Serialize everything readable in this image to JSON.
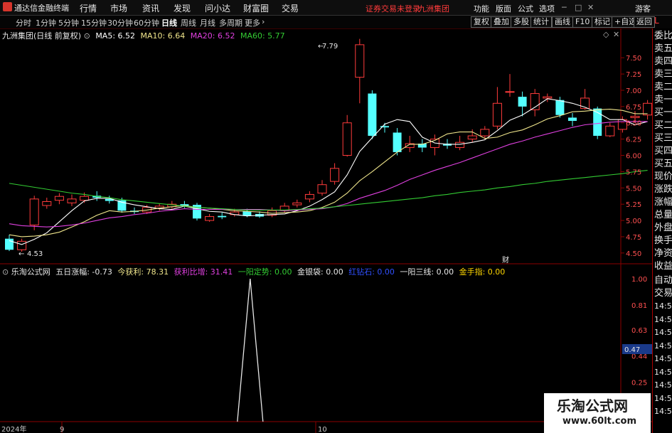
{
  "menubar": {
    "app_title": "通达信金融终端",
    "items": [
      "行情",
      "市场",
      "资讯",
      "发现",
      "问小达",
      "财富圈",
      "交易"
    ],
    "warning": "证券交易未登录",
    "stock_name": "九洲集团",
    "right_items": [
      "功能",
      "版面",
      "公式",
      "选项"
    ],
    "guest": "游客"
  },
  "periodbar": {
    "periods": [
      "分时",
      "1分钟",
      "5分钟",
      "15分钟",
      "30分钟",
      "60分钟",
      "日线",
      "周线",
      "月线",
      "多周期",
      "更多"
    ],
    "active": "日线",
    "buttons": [
      "复权",
      "叠加",
      "多股",
      "统计",
      "画线",
      "F10",
      "标记",
      "+自选",
      "返回"
    ]
  },
  "main_chart": {
    "title": "九洲集团(日线 前复权)",
    "ma": [
      {
        "label": "MA5: 6.52",
        "color": "#ffffff"
      },
      {
        "label": "MA10: 6.64",
        "color": "#f0e68c"
      },
      {
        "label": "MA20: 6.52",
        "color": "#e040e0"
      },
      {
        "label": "MA60: 5.77",
        "color": "#33cc33"
      }
    ],
    "high_label": "7.79",
    "low_label": "4.53",
    "cai_mark": "财",
    "y_ticks": [
      "7.50",
      "7.25",
      "7.00",
      "6.75",
      "6.50",
      "6.25",
      "6.00",
      "5.75",
      "5.50",
      "5.25",
      "5.00",
      "4.75",
      "4.50"
    ]
  },
  "indicator": {
    "name": "乐淘公式网",
    "fields": [
      {
        "label": "五日涨幅: -0.73",
        "color": "#e8e8e8"
      },
      {
        "label": "今获利: 78.31",
        "color": "#f0e68c"
      },
      {
        "label": "获利比增: 31.41",
        "color": "#e040e0"
      },
      {
        "label": "一阳定势: 0.00",
        "color": "#33cc33"
      },
      {
        "label": "金银袋: 0.00",
        "color": "#e8e8e8"
      },
      {
        "label": "红钻石: 0.00",
        "color": "#3050ff"
      },
      {
        "label": "一阳三线: 0.00",
        "color": "#e8e8e8"
      },
      {
        "label": "金手指: 0.00",
        "color": "#ffd700"
      }
    ],
    "y_ticks": [
      "1.00",
      "0.81",
      "0.63",
      "0.44",
      "0.25",
      "0.06"
    ],
    "cursor_value": "0.47"
  },
  "x_axis": {
    "labels": [
      "2024年",
      "9",
      "10"
    ]
  },
  "right_panel": {
    "items": [
      "委比",
      "卖五",
      "卖四",
      "卖三",
      "卖二",
      "卖一",
      "买一",
      "买二",
      "买三",
      "买四",
      "买五",
      "现价",
      "涨跌",
      "涨幅",
      "总量",
      "外盘",
      "换手",
      "净资",
      "收益"
    ],
    "top_letter": "L",
    "lower_items": [
      "自动",
      "交易"
    ],
    "times": [
      "14:56",
      "14:56",
      "14:56",
      "14:56",
      "14:56",
      "14:56",
      "14:56",
      "14:56",
      "14:56"
    ]
  },
  "watermark": {
    "title": "乐淘公式网",
    "url": "www.60lt.com"
  },
  "chart_data": {
    "type": "candlestick",
    "ylim": [
      4.4,
      7.95
    ],
    "candles": [
      [
        4.72,
        4.55,
        4.78,
        4.53
      ],
      [
        4.55,
        4.68,
        4.72,
        4.52
      ],
      [
        4.93,
        5.33,
        5.38,
        4.85
      ],
      [
        5.23,
        5.29,
        5.35,
        5.18
      ],
      [
        5.31,
        5.37,
        5.42,
        5.25
      ],
      [
        5.27,
        5.33,
        5.4,
        5.22
      ],
      [
        5.31,
        5.37,
        5.43,
        5.27
      ],
      [
        5.38,
        5.35,
        5.45,
        5.3
      ],
      [
        5.33,
        5.3,
        5.38,
        5.26
      ],
      [
        5.31,
        5.15,
        5.35,
        5.12
      ],
      [
        5.15,
        5.13,
        5.2,
        5.1
      ],
      [
        5.13,
        5.2,
        5.24,
        5.1
      ],
      [
        5.19,
        5.22,
        5.26,
        5.15
      ],
      [
        5.21,
        5.25,
        5.3,
        5.18
      ],
      [
        5.25,
        5.22,
        5.3,
        5.19
      ],
      [
        5.24,
        5.03,
        5.27,
        5.0
      ],
      [
        5.0,
        5.06,
        5.1,
        4.98
      ],
      [
        5.07,
        5.05,
        5.12,
        5.02
      ],
      [
        5.09,
        5.13,
        5.18,
        5.06
      ],
      [
        5.14,
        5.07,
        5.18,
        5.05
      ],
      [
        5.1,
        5.06,
        5.14,
        5.04
      ],
      [
        5.08,
        5.15,
        5.2,
        5.05
      ],
      [
        5.15,
        5.22,
        5.27,
        5.12
      ],
      [
        5.24,
        5.27,
        5.32,
        5.2
      ],
      [
        5.33,
        5.4,
        5.45,
        5.28
      ],
      [
        5.42,
        5.55,
        5.62,
        5.38
      ],
      [
        5.6,
        5.8,
        5.88,
        5.55
      ],
      [
        6.0,
        6.5,
        6.62,
        5.98
      ],
      [
        7.2,
        7.7,
        7.79,
        6.8
      ],
      [
        6.95,
        6.3,
        7.0,
        6.25
      ],
      [
        6.45,
        6.43,
        6.5,
        6.35
      ],
      [
        6.35,
        6.05,
        6.42,
        6.0
      ],
      [
        6.12,
        6.18,
        6.3,
        6.05
      ],
      [
        6.18,
        6.12,
        6.25,
        6.05
      ],
      [
        6.12,
        6.25,
        6.32,
        6.0
      ],
      [
        6.18,
        6.15,
        6.25,
        6.1
      ],
      [
        6.12,
        6.2,
        6.3,
        6.08
      ],
      [
        6.25,
        6.3,
        6.4,
        6.2
      ],
      [
        6.3,
        6.4,
        6.45,
        6.25
      ],
      [
        6.45,
        6.8,
        7.05,
        6.4
      ],
      [
        6.98,
        6.98,
        7.25,
        6.9
      ],
      [
        6.9,
        6.75,
        6.98,
        6.6
      ],
      [
        6.7,
        6.95,
        7.02,
        6.6
      ],
      [
        6.88,
        6.9,
        6.95,
        6.82
      ],
      [
        6.85,
        6.62,
        6.9,
        6.58
      ],
      [
        6.58,
        6.53,
        6.65,
        6.45
      ],
      [
        6.72,
        6.88,
        7.02,
        6.7
      ],
      [
        6.72,
        6.3,
        6.75,
        6.25
      ],
      [
        6.3,
        6.45,
        6.5,
        6.28
      ],
      [
        6.4,
        6.55,
        6.6,
        6.35
      ],
      [
        6.58,
        6.6,
        6.68,
        6.52
      ],
      [
        6.62,
        6.8,
        6.85,
        6.55
      ]
    ],
    "series": [
      {
        "name": "MA5",
        "values": [
          4.69,
          4.63,
          4.71,
          4.81,
          4.98,
          5.15,
          5.3,
          5.34,
          5.34,
          5.28,
          5.24,
          5.21,
          5.18,
          5.17,
          5.22,
          5.18,
          5.14,
          5.13,
          5.09,
          5.07,
          5.08,
          5.09,
          5.1,
          5.15,
          5.22,
          5.32,
          5.44,
          5.7,
          6.06,
          6.27,
          6.48,
          6.55,
          6.52,
          6.28,
          6.19,
          6.17,
          6.17,
          6.2,
          6.24,
          6.38,
          6.54,
          6.62,
          6.74,
          6.87,
          6.84,
          6.8,
          6.74,
          6.66,
          6.55,
          6.55,
          6.47,
          6.52
        ]
      },
      {
        "name": "MA10",
        "values": [
          4.78,
          4.75,
          4.76,
          4.78,
          4.82,
          4.9,
          4.98,
          5.08,
          5.15,
          5.13,
          5.14,
          5.16,
          5.19,
          5.21,
          5.23,
          5.2,
          5.19,
          5.17,
          5.15,
          5.14,
          5.13,
          5.11,
          5.12,
          5.13,
          5.15,
          5.2,
          5.28,
          5.42,
          5.61,
          5.75,
          5.9,
          6.05,
          6.17,
          6.17,
          6.23,
          6.33,
          6.36,
          6.36,
          6.26,
          6.28,
          6.35,
          6.39,
          6.47,
          6.56,
          6.61,
          6.67,
          6.68,
          6.7,
          6.71,
          6.69,
          6.64,
          6.64
        ]
      },
      {
        "name": "MA20",
        "values": [
          4.95,
          4.92,
          4.91,
          4.9,
          4.91,
          4.93,
          4.96,
          5.0,
          5.04,
          5.06,
          5.09,
          5.11,
          5.14,
          5.16,
          5.18,
          5.17,
          5.17,
          5.17,
          5.17,
          5.17,
          5.17,
          5.16,
          5.15,
          5.16,
          5.17,
          5.18,
          5.21,
          5.26,
          5.34,
          5.4,
          5.46,
          5.54,
          5.63,
          5.7,
          5.77,
          5.83,
          5.89,
          5.96,
          6.03,
          6.1,
          6.17,
          6.22,
          6.28,
          6.33,
          6.38,
          6.43,
          6.47,
          6.49,
          6.51,
          6.52,
          6.52,
          6.52
        ]
      },
      {
        "name": "MA60",
        "values": [
          5.57,
          5.54,
          5.51,
          5.48,
          5.45,
          5.42,
          5.4,
          5.37,
          5.35,
          5.32,
          5.3,
          5.28,
          5.26,
          5.24,
          5.22,
          5.2,
          5.19,
          5.18,
          5.17,
          5.16,
          5.16,
          5.16,
          5.16,
          5.17,
          5.18,
          5.19,
          5.21,
          5.23,
          5.25,
          5.27,
          5.29,
          5.31,
          5.33,
          5.35,
          5.38,
          5.4,
          5.43,
          5.45,
          5.47,
          5.5,
          5.52,
          5.55,
          5.57,
          5.6,
          5.62,
          5.64,
          5.66,
          5.68,
          5.7,
          5.72,
          5.75,
          5.77
        ]
      }
    ],
    "indicator_spike": {
      "index": 18,
      "value": 1.0,
      "baseline": 0.0
    }
  }
}
